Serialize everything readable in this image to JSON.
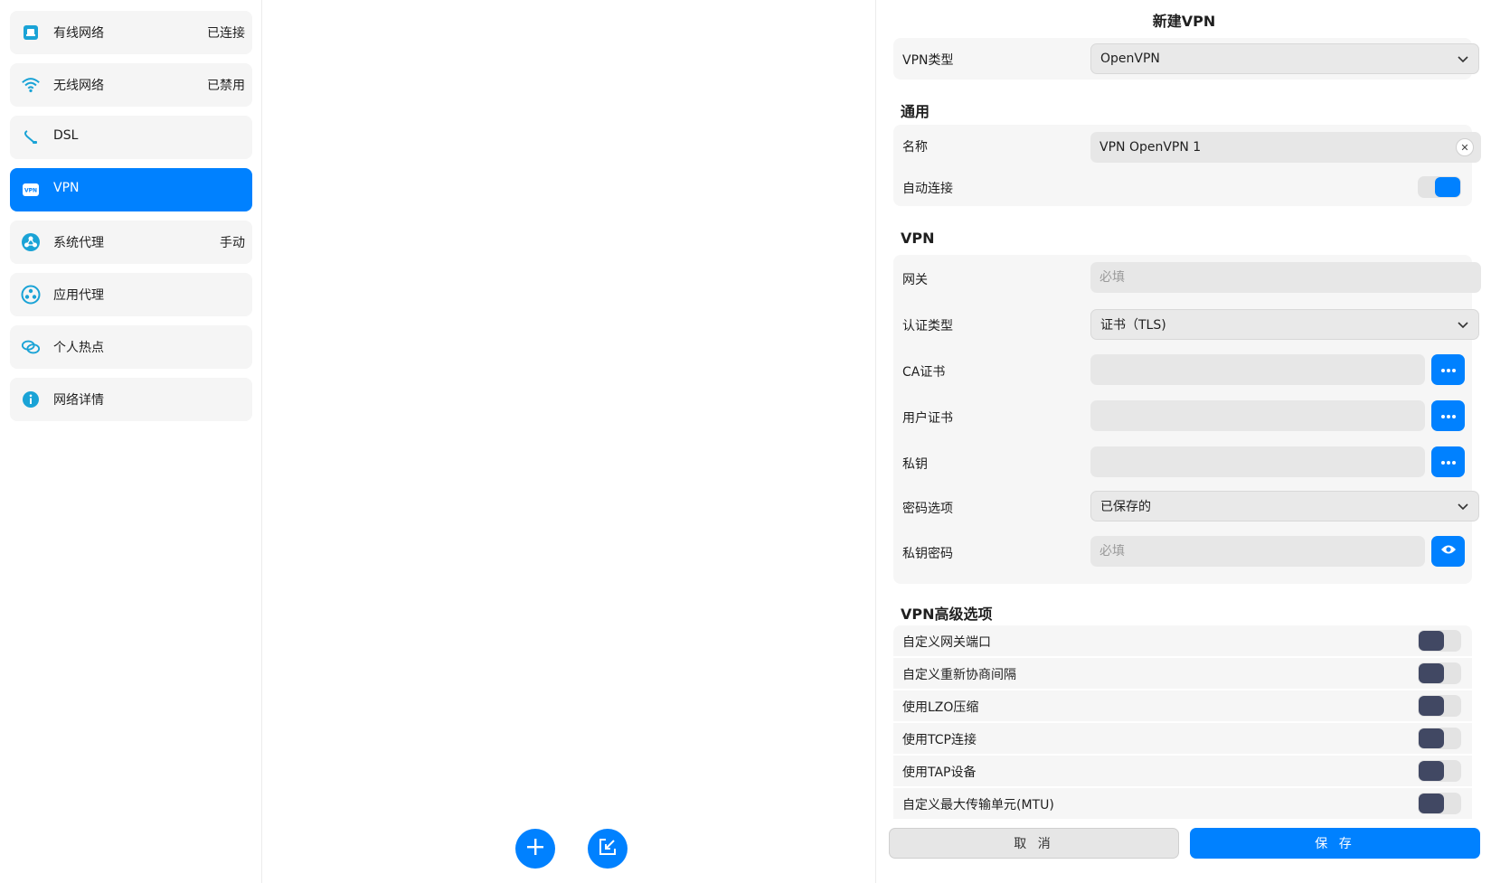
{
  "sidebar": {
    "items": [
      {
        "label": "有线网络",
        "status": "已连接",
        "icon": "wired-network-icon"
      },
      {
        "label": "无线网络",
        "status": "已禁用",
        "icon": "wifi-icon"
      },
      {
        "label": "DSL",
        "status": "",
        "icon": "dsl-icon"
      },
      {
        "label": "VPN",
        "status": "",
        "icon": "vpn-icon",
        "icon_text": "VPN"
      },
      {
        "label": "系统代理",
        "status": "手动",
        "icon": "system-proxy-icon"
      },
      {
        "label": "应用代理",
        "status": "",
        "icon": "app-proxy-icon"
      },
      {
        "label": "个人热点",
        "status": "",
        "icon": "hotspot-icon"
      },
      {
        "label": "网络详情",
        "status": "",
        "icon": "info-icon"
      }
    ]
  },
  "form": {
    "title": "新建VPN",
    "vpn_type_label": "VPN类型",
    "vpn_type_value": "OpenVPN",
    "general_title": "通用",
    "name_label": "名称",
    "name_value": "VPN OpenVPN 1",
    "auto_connect_label": "自动连接",
    "auto_connect": true,
    "vpn_section_title": "VPN",
    "gateway_label": "网关",
    "gateway_placeholder": "必填",
    "auth_type_label": "认证类型",
    "auth_type_value": "证书（TLS)",
    "ca_cert_label": "CA证书",
    "user_cert_label": "用户证书",
    "private_key_label": "私钥",
    "password_option_label": "密码选项",
    "password_option_value": "已保存的",
    "private_key_password_label": "私钥密码",
    "private_key_password_placeholder": "必填",
    "advanced_title": "VPN高级选项",
    "advanced": [
      {
        "label": "自定义网关端口",
        "on": false
      },
      {
        "label": "自定义重新协商间隔",
        "on": false
      },
      {
        "label": "使用LZO压缩",
        "on": false
      },
      {
        "label": "使用TCP连接",
        "on": false
      },
      {
        "label": "使用TAP设备",
        "on": false
      },
      {
        "label": "自定义最大传输单元(MTU)",
        "on": false
      }
    ]
  },
  "buttons": {
    "cancel": "取 消",
    "save": "保 存"
  },
  "colors": {
    "accent": "#0081ff",
    "toggle_off_knob": "#414863"
  }
}
